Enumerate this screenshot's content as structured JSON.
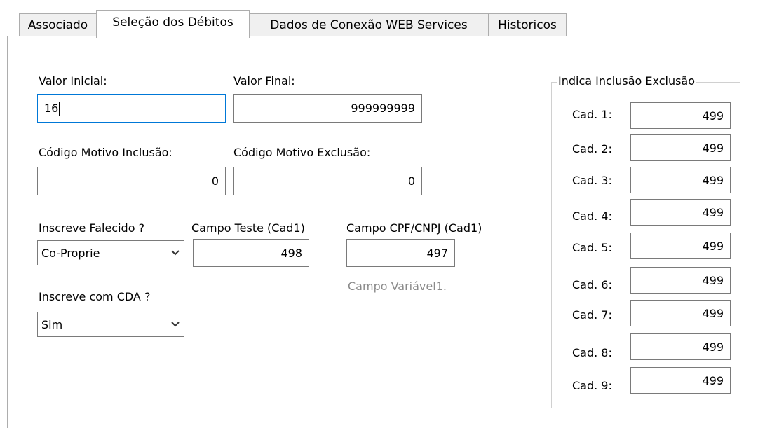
{
  "tabs": [
    {
      "label": "Associado"
    },
    {
      "label": "Seleção dos Débitos"
    },
    {
      "label": "Dados de Conexão WEB Services"
    },
    {
      "label": "Historicos"
    }
  ],
  "form": {
    "valor_inicial": {
      "label": "Valor Inicial:",
      "value": "16"
    },
    "valor_final": {
      "label": "Valor Final:",
      "value": "999999999"
    },
    "codigo_inclusao": {
      "label": "Código Motivo Inclusão:",
      "value": "0"
    },
    "codigo_exclusao": {
      "label": "Código Motivo Exclusão:",
      "value": "0"
    },
    "inscreve_falecido": {
      "label": "Inscreve Falecido ?",
      "value": "Co-Proprie"
    },
    "campo_teste": {
      "label": "Campo Teste (Cad1)",
      "value": "498"
    },
    "campo_cpf": {
      "label": "Campo CPF/CNPJ (Cad1)",
      "value": "497"
    },
    "campo_variavel_hint": "Campo Variável1.",
    "inscreve_cda": {
      "label": "Inscreve com CDA ?",
      "value": "Sim"
    }
  },
  "indica": {
    "title": "Indica Inclusão Exclusão",
    "rows": [
      {
        "label": "Cad. 1:",
        "value": "499"
      },
      {
        "label": "Cad. 2:",
        "value": "499"
      },
      {
        "label": "Cad. 3:",
        "value": "499"
      },
      {
        "label": "Cad. 4:",
        "value": "499"
      },
      {
        "label": "Cad. 5:",
        "value": "499"
      },
      {
        "label": "Cad. 6:",
        "value": "499"
      },
      {
        "label": "Cad. 7:",
        "value": "499"
      },
      {
        "label": "Cad. 8:",
        "value": "499"
      },
      {
        "label": "Cad. 9:",
        "value": "499"
      }
    ]
  },
  "icons": {
    "dropdown": "chevron-down-icon"
  },
  "colors": {
    "focus_border": "#0078d7",
    "hint_text": "#8a8a8a"
  }
}
